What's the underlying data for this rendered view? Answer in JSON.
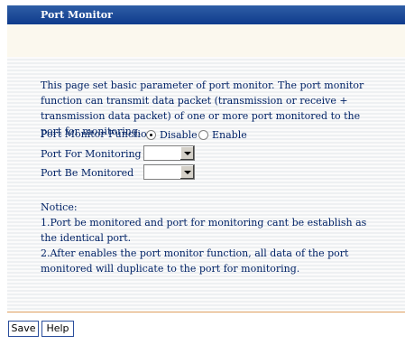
{
  "header": {
    "title": "Port Monitor"
  },
  "intro": "This page set basic parameter of port monitor. The port monitor function can transmit data packet (transmission or receive + transmission data packet) of one or more port monitored to the port for monitoring.",
  "function": {
    "label": "Port Monitor Function",
    "options": [
      "Disable",
      "Enable"
    ],
    "selected": "Disable"
  },
  "monitoring": {
    "label": "Port For Monitoring",
    "value": ""
  },
  "monitored": {
    "label": "Port Be Monitored",
    "value": ""
  },
  "notice": {
    "title": "Notice:",
    "item1": "1.Port be monitored and port for monitoring cant be establish as the identical port.",
    "item2": "2.After enables the port monitor function, all data of the port monitored will duplicate to the port for monitoring."
  },
  "buttons": {
    "save": "Save",
    "help": "Help"
  }
}
